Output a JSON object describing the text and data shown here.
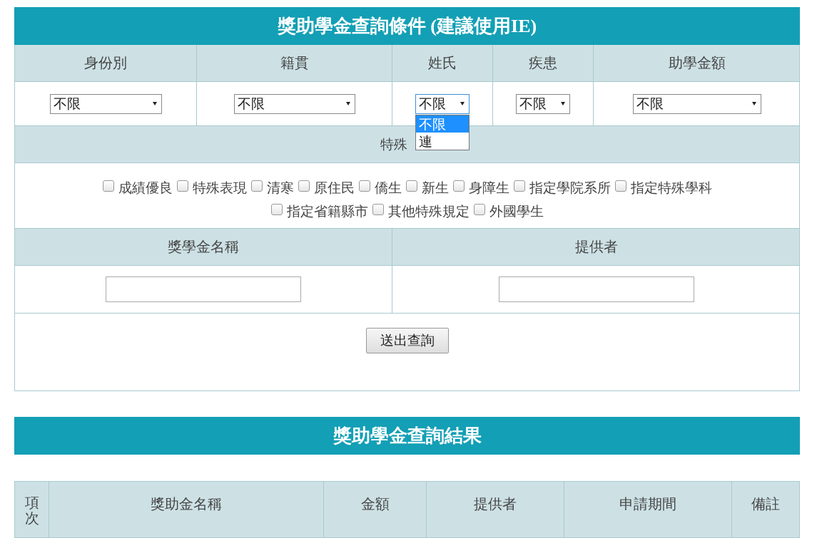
{
  "search_panel": {
    "title": "獎助學金查詢條件 (建議使用IE)",
    "filters": [
      {
        "label": "身份別",
        "value": "不限",
        "expanded": false
      },
      {
        "label": "籍貫",
        "value": "不限",
        "expanded": false
      },
      {
        "label": "姓氏",
        "value": "不限",
        "expanded": true,
        "options": [
          {
            "label": "不限",
            "selected": true
          },
          {
            "label": "連",
            "selected": false
          }
        ]
      },
      {
        "label": "疾患",
        "value": "不限",
        "expanded": false
      },
      {
        "label": "助學金額",
        "value": "不限",
        "expanded": false
      }
    ],
    "special_heading": "特殊",
    "special_options": [
      {
        "label": "成績優良",
        "checked": false
      },
      {
        "label": "特殊表現",
        "checked": false
      },
      {
        "label": "清寒",
        "checked": false
      },
      {
        "label": "原住民",
        "checked": false
      },
      {
        "label": "僑生",
        "checked": false
      },
      {
        "label": "新生",
        "checked": false
      },
      {
        "label": "身障生",
        "checked": false
      },
      {
        "label": "指定學院系所",
        "checked": false
      },
      {
        "label": "指定特殊學科",
        "checked": false
      },
      {
        "label": "指定省籍縣市",
        "checked": false
      },
      {
        "label": "其他特殊規定",
        "checked": false
      },
      {
        "label": "外國學生",
        "checked": false
      }
    ],
    "text_fields": [
      {
        "label": "獎學金名稱"
      },
      {
        "label": "提供者"
      }
    ],
    "submit_button": "送出查詢"
  },
  "results": {
    "title": "獎助學金查詢結果",
    "columns": [
      "項次",
      "獎助金名稱",
      "金額",
      "提供者",
      "申請期間",
      "備註"
    ]
  }
}
